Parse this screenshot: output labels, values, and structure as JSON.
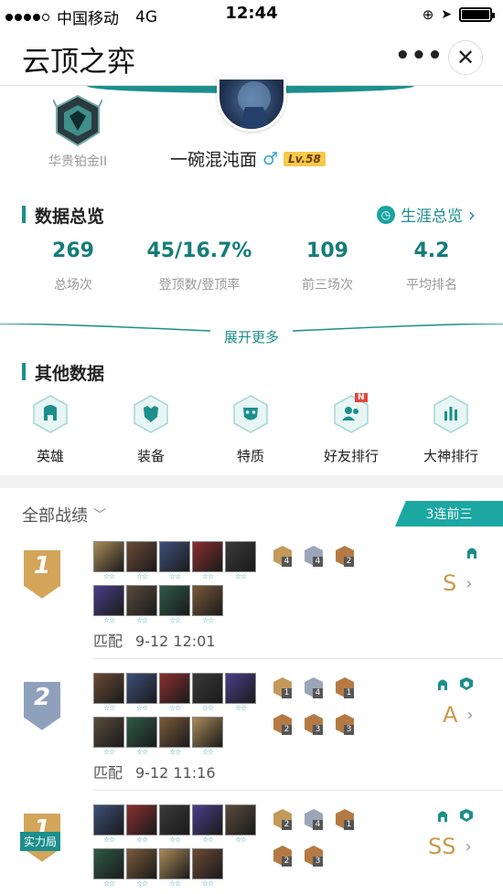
{
  "status_bar": {
    "carrier": "中国移动",
    "network": "4G",
    "time": "12:44"
  },
  "nav": {
    "title": "云顶之弈",
    "more": "•••",
    "close": "✕"
  },
  "profile": {
    "rank": "华贵铂金II",
    "username": "一碗混沌面",
    "gender_symbol": "♂",
    "level": "Lv.58"
  },
  "overview": {
    "title": "数据总览",
    "career_link": "生涯总览",
    "career_arrow": "›",
    "stats": [
      {
        "value": "269",
        "label": "总场次"
      },
      {
        "value": "45/16.7%",
        "label": "登顶数/登顶率"
      },
      {
        "value": "109",
        "label": "前三场次"
      },
      {
        "value": "4.2",
        "label": "平均排名"
      }
    ],
    "expand": "展开更多"
  },
  "other": {
    "title": "其他数据",
    "items": [
      {
        "label": "英雄",
        "icon": "helmet-icon"
      },
      {
        "label": "装备",
        "icon": "armor-icon"
      },
      {
        "label": "特质",
        "icon": "mask-icon"
      },
      {
        "label": "好友排行",
        "icon": "friends-icon",
        "badge": "N"
      },
      {
        "label": "大神排行",
        "icon": "bar-chart-icon"
      }
    ]
  },
  "history": {
    "title": "全部战绩",
    "streak": "3连前三",
    "matches": [
      {
        "place": "1",
        "mode": "匹配",
        "time": "9-12 12:01",
        "grade": "S",
        "champs_row1": 5,
        "champs_row2": 4,
        "stars": "☆☆",
        "traits": [
          {
            "count": "4",
            "color": "#c39a5b"
          },
          {
            "count": "4",
            "color": "#9aa6b8"
          },
          {
            "count": "2",
            "color": "#b57a44"
          }
        ],
        "class_icons": [
          "helmet-icon"
        ]
      },
      {
        "place": "2",
        "mode": "匹配",
        "time": "9-12 11:16",
        "grade": "A",
        "champs_row1": 5,
        "champs_row2": 4,
        "stars": "☆☆",
        "traits": [
          {
            "count": "1",
            "color": "#c39a5b"
          },
          {
            "count": "4",
            "color": "#9aa6b8"
          },
          {
            "count": "1",
            "color": "#b57a44"
          },
          {
            "count": "2",
            "color": "#b57a44"
          },
          {
            "count": "3",
            "color": "#b57a44"
          },
          {
            "count": "3",
            "color": "#b57a44"
          }
        ],
        "class_icons": [
          "helmet-icon",
          "shield-icon"
        ]
      },
      {
        "place": "1",
        "tag": "实力局",
        "grade": "SS",
        "champs_row1": 5,
        "champs_row2": 4,
        "stars": "☆☆",
        "traits": [
          {
            "count": "2",
            "color": "#c39a5b"
          },
          {
            "count": "4",
            "color": "#9aa6b8"
          },
          {
            "count": "1",
            "color": "#b57a44"
          },
          {
            "count": "2",
            "color": "#b57a44"
          },
          {
            "count": "3",
            "color": "#b57a44"
          }
        ],
        "class_icons": [
          "helmet-icon",
          "shield-icon"
        ]
      }
    ]
  },
  "colors": {
    "accent": "#1c8f8c",
    "gold": "#c9994a",
    "silver": "#8fa0bd"
  }
}
